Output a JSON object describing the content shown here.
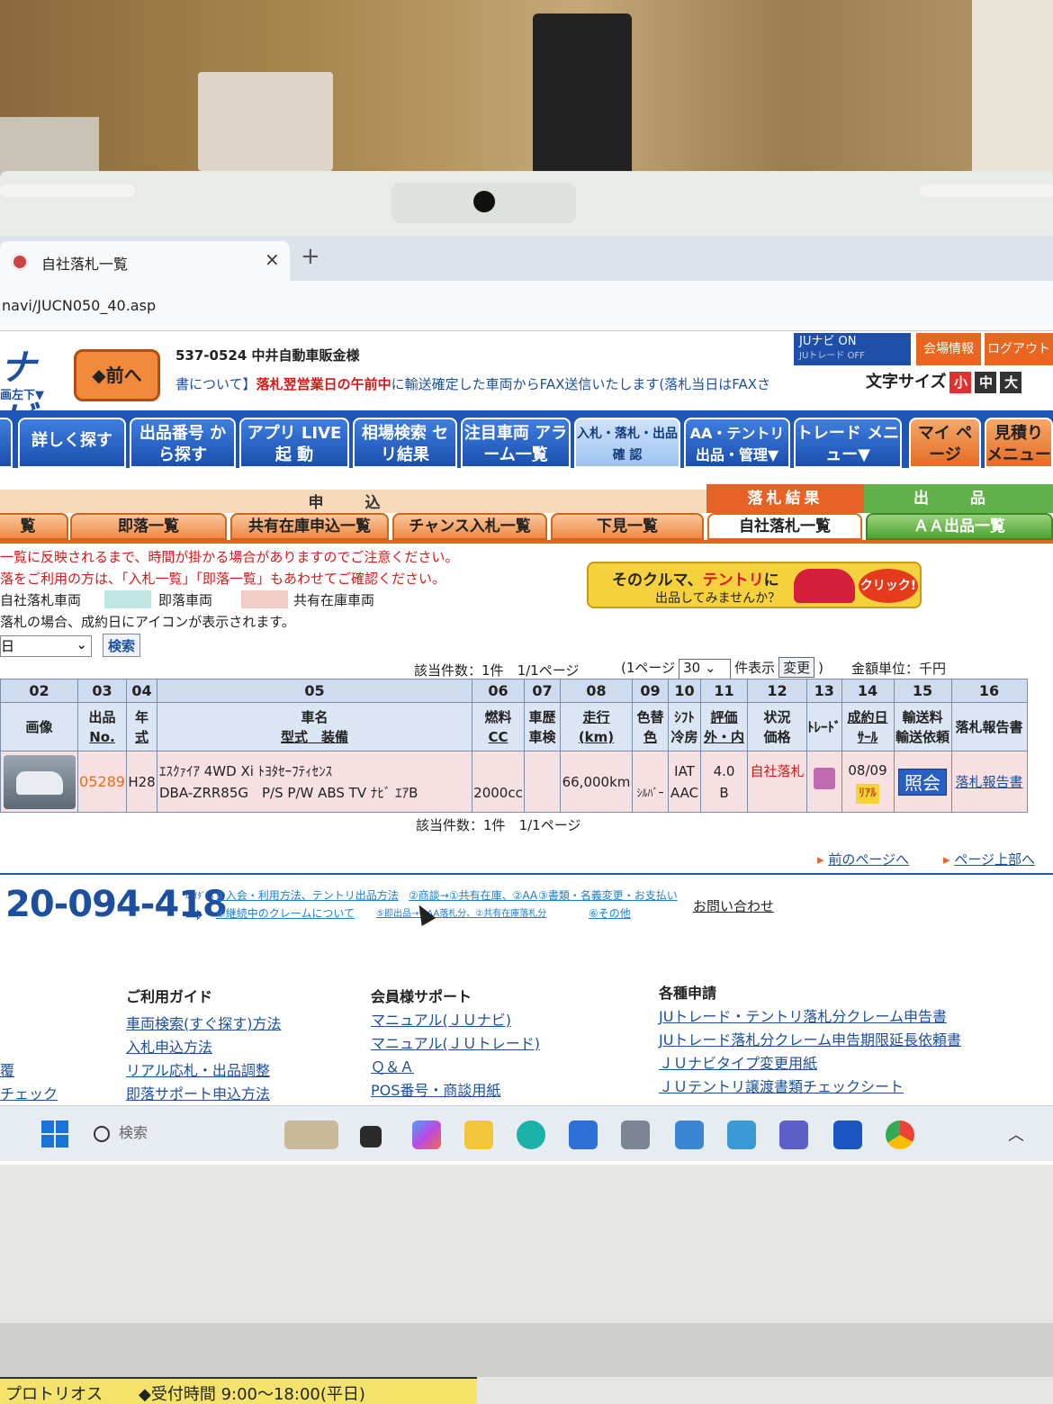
{
  "browser": {
    "tab_title": "自社落札一覧",
    "tab_close": "×",
    "new_tab": "+",
    "url": "navi/JUCN050_40.asp"
  },
  "header": {
    "logo_text": "ナビ",
    "logo_sub": "画左下▼",
    "back_label": "◆前へ",
    "dealer_name": "537-0524 中井自動車販金様",
    "notice_link": "書について】",
    "notice_red": "落札翌営業日の午前中",
    "notice_tail": "に輸送確定した車両からFAX送信いたします(落札当日はFAXさ",
    "ju_switch_on": "JUナビ ON",
    "ju_switch_off": "JUトレード OFF",
    "kaijo_label": "会場情報",
    "logout_label": "ログアウト",
    "fontsize_label": "文字サイズ",
    "fontsize_small": "小",
    "fontsize_mid": "中",
    "fontsize_large": "大"
  },
  "mainnav": [
    {
      "label": "詳しく探す"
    },
    {
      "label": "出品番号 から探す"
    },
    {
      "label": "アプリ LIVE 起 動"
    },
    {
      "label": "相場検索 セリ結果"
    },
    {
      "label": "注目車両 アラーム一覧"
    },
    {
      "label": "入札・落札・出品 確 認"
    },
    {
      "label": "AA・テントリ 出品・管理▼"
    },
    {
      "label": "トレード メニュー▼"
    },
    {
      "label": "マイ ページ"
    },
    {
      "label": "見積り メニュー"
    }
  ],
  "subnav": {
    "group_moshikomi": "申 込",
    "group_rakusatsu": "落札結果",
    "group_shuppin": "出 品",
    "tabs": [
      {
        "label": "覧"
      },
      {
        "label": "即落一覧"
      },
      {
        "label": "共有在庫申込一覧"
      },
      {
        "label": "チャンス入札一覧"
      },
      {
        "label": "下見一覧"
      },
      {
        "label": "自社落札一覧"
      },
      {
        "label": "ＡＡ出品一覧"
      }
    ]
  },
  "notices": {
    "line1": "一覧に反映されるまで、時間が掛かる場合がありますのでご注意ください。",
    "line2": "落をご利用の方は、「入札一覧」「即落一覧」もあわせてご確認ください。",
    "legend_self": "自社落札車両",
    "legend_soku": "即落車両",
    "legend_shared": "共有在庫車両",
    "auction_note": "落札の場合、成約日にアイコンが表示されます。"
  },
  "banner": {
    "line1_a": "そのクルマ、",
    "line1_b": "テントリ",
    "line1_c": "に",
    "line2": "出品してみませんか？",
    "click": "クリック!"
  },
  "search": {
    "date_value": "日",
    "button": "検索"
  },
  "countbar": {
    "count": "該当件数：1件",
    "page": "1/1ページ",
    "per_page_prefix": "(1ページ",
    "per_page_value": "30",
    "per_page_suffix": "件表示",
    "change_btn": "変更",
    "close_paren": ")",
    "unit": "金額単位：千円"
  },
  "table": {
    "col_numbers": [
      "02",
      "03",
      "04",
      "05",
      "06",
      "07",
      "08",
      "09",
      "10",
      "11",
      "12",
      "13",
      "14",
      "15",
      "16"
    ],
    "headers": {
      "c02": "画像",
      "c03a": "出品",
      "c03b": "No.",
      "c04a": "年",
      "c04b": "式",
      "c05a": "車名",
      "c05b": "型式　装備",
      "c06a": "燃料",
      "c06b": "CC",
      "c07a": "車歴",
      "c07b": "車検",
      "c08a": "走行",
      "c08b": "(km)",
      "c09a": "色替",
      "c09b": "色",
      "c10a": "ｼﾌﾄ",
      "c10b": "冷房",
      "c11a": "評価",
      "c11b": "外・内",
      "c12a": "状況",
      "c12b": "価格",
      "c13": "ﾄﾚｰﾄﾞ",
      "c14a": "成約日",
      "c14b": "ｻｰﾙ",
      "c15a": "輸送料",
      "c15b": "輸送依頼",
      "c16": "落札報告書"
    },
    "rows": [
      {
        "lot": "05289",
        "year": "H28",
        "name": "ｴｽｸｧｲｱ 4WD Xi ﾄﾖﾀｾｰﾌﾃｨｾﾝｽ",
        "model": "DBA-ZRR85G　P/S P/W ABS TV ﾅﾋﾞ ｴｱB",
        "cc": "2000cc",
        "mileage": "66,000km",
        "color": "ｼﾙﾊﾞｰ",
        "shift": "IAT",
        "ac": "AAC",
        "grade": "4.0",
        "grade_int": "B",
        "status": "自社落札",
        "settle_date": "08/09",
        "real": "ﾘｱﾙ",
        "inquiry": "照会",
        "report": "落札報告書"
      }
    ]
  },
  "bottom_count": {
    "count": "該当件数：1件",
    "page": "1/1ページ"
  },
  "pager": {
    "prev": "前のページへ",
    "top": "ページ上部へ"
  },
  "footer": {
    "phone": "20-094-418",
    "guidance": "ｶﾞｲﾀﾞﾝｽ",
    "faq1": "①入会・利用方法、テントリ出品方法",
    "faq2": "②商談→①共有在庫、②AA",
    "faq3": "③書類・名義変更・お支払い",
    "faq4": "④継続中のクレームについて",
    "faq5": "⑤即出品→①AA落札分、②共有在庫落札分",
    "faq6": "⑥その他",
    "contact": "お問い合わせ",
    "col1_title": "ご利用ガイド",
    "col1_links": [
      "車両検索(すぐ探す)方法",
      "入札申込方法",
      "リアル応札・出品調整",
      "即落サポート申込方法"
    ],
    "col2_title": "会員様サポート",
    "col2_links": [
      "マニュアル(ＪＵナビ)",
      "マニュアル(ＪＵトレード)",
      "Ｑ＆Ａ",
      "POS番号・商談用紙"
    ],
    "col3_title": "各種申請",
    "col3_links": [
      "JUトレード・テントリ落札分クレーム申告書",
      "JUトレード落札分クレーム申告期限延長依頼書",
      "ＪＵナビタイプ変更用紙",
      "ＪＵテントリ譲渡書類チェックシート"
    ],
    "left_frag1": "覆",
    "left_frag2": "チェック"
  },
  "taskbar": {
    "search_placeholder": "検索",
    "tray": "︿"
  },
  "sticker": {
    "left": "プロトリオス",
    "hours": "◆受付時間 9:00〜18:00(平日)"
  },
  "colors": {
    "nav_blue": "#1e56b8",
    "accent_orange": "#e76325",
    "row_pink": "#f7e0e2",
    "legend_soku": "#bfe6e2",
    "legend_shared": "#f2cdc8",
    "alert_red": "#d81818"
  }
}
